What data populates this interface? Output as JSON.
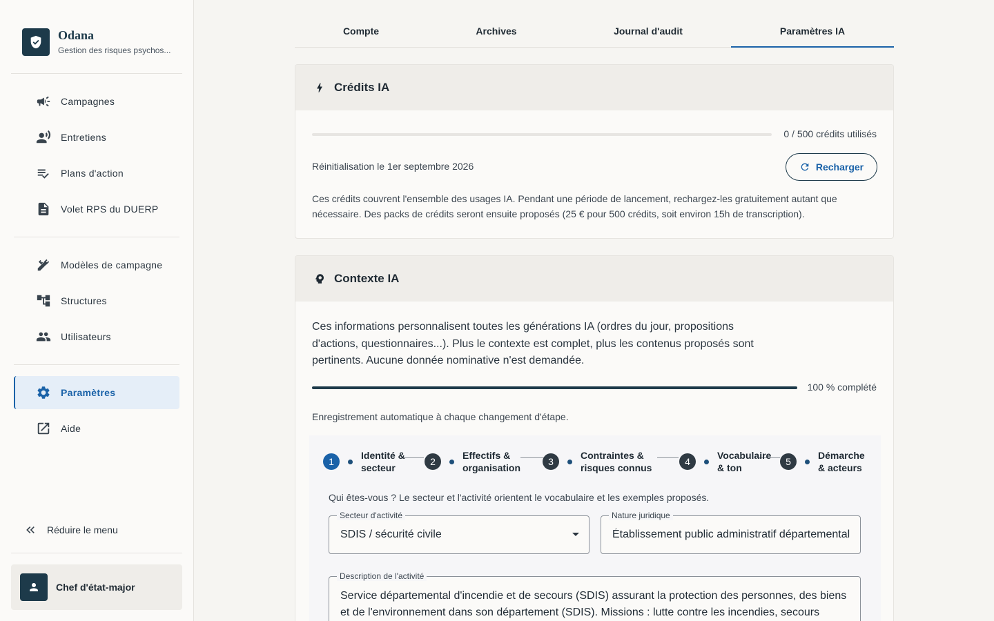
{
  "brand": {
    "name": "Odana",
    "subtitle": "Gestion des risques psychos..."
  },
  "nav": {
    "main": [
      "Campagnes",
      "Entretiens",
      "Plans d'action",
      "Volet RPS du DUERP"
    ],
    "admin": [
      "Modèles de campagne",
      "Structures",
      "Utilisateurs"
    ],
    "settings": "Paramètres",
    "help": "Aide",
    "collapse": "Réduire le menu"
  },
  "user": {
    "name": "Chef d'état-major"
  },
  "tabs": [
    "Compte",
    "Archives",
    "Journal d'audit",
    "Paramètres IA"
  ],
  "credits": {
    "title": "Crédits IA",
    "usage": "0 / 500 crédits utilisés",
    "usage_fraction": 0,
    "reset": "Réinitialisation le 1er septembre 2026",
    "reload": "Recharger",
    "description": "Ces crédits couvrent l'ensemble des usages IA. Pendant une période de lancement, rechargez-les gratuitement autant que nécessaire. Des packs de crédits seront ensuite proposés (25 € pour 500 crédits, soit environ 15h de transcription)."
  },
  "context": {
    "title": "Contexte IA",
    "intro": "Ces informations personnalisent toutes les générations IA (ordres du jour, propositions d'actions, questionnaires...). Plus le contexte est complet, plus les contenus proposés sont pertinents. Aucune donnée nominative n'est demandée.",
    "completion": "100 % complété",
    "completion_fraction": 1,
    "autosave": "Enregistrement automatique à chaque changement d'étape.",
    "steps": [
      {
        "num": "1",
        "line1": "Identité &",
        "line2": "secteur"
      },
      {
        "num": "2",
        "line1": "Effectifs &",
        "line2": "organisation"
      },
      {
        "num": "3",
        "line1": "Contraintes &",
        "line2": "risques connus"
      },
      {
        "num": "4",
        "line1": "Vocabulaire",
        "line2": "& ton"
      },
      {
        "num": "5",
        "line1": "Démarche",
        "line2": "& acteurs"
      }
    ],
    "step_hint": "Qui êtes-vous ? Le secteur et l'activité orientent le vocabulaire et les exemples proposés.",
    "sector": {
      "label": "Secteur d'activité",
      "value": "SDIS / sécurité civile"
    },
    "legal": {
      "label": "Nature juridique",
      "value": "Établissement public administratif départemental"
    },
    "activity": {
      "label": "Description de l'activité",
      "value": "Service départemental d'incendie et de secours (SDIS) assurant la protection des personnes, des biens et de l'environnement dans son département (SDIS). Missions : lutte contre les incendies, secours"
    }
  }
}
